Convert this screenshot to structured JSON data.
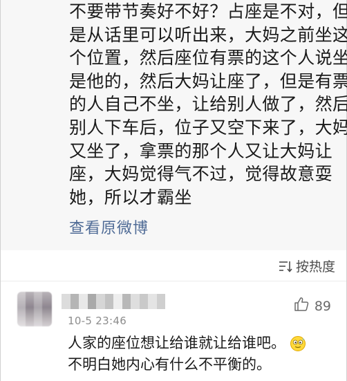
{
  "post": {
    "lines": [
      "不要带节奏好不好？占座是不对，但",
      "是从话里可以听出来，大妈之前坐这",
      "个位置，然后座位有票的这个人说坐",
      "是他的，然后大妈让座了，但是有票",
      "的人自己不坐，让给别人做了，然后",
      "别人下车后，位子又空下来了，大妈",
      "又坐了，拿票的那个人又让大妈让",
      "座，大妈觉得气不过，觉得故意耍",
      "她，所以才霸坐"
    ],
    "view_original": "查看原微博"
  },
  "sort": {
    "label": "按热度",
    "icon": "sort-lines-icon"
  },
  "comment": {
    "timestamp": "10-5 23:46",
    "likes": "89",
    "lines": [
      "人家的座位想让给谁就让给谁吧。",
      "不明白她内心有什么不平衡的。"
    ],
    "emoji_icon": "sweat-smile-emoji-icon",
    "like_icon": "thumbs-up-icon",
    "colors": {
      "link": "#4f6b96",
      "post_background": "#f7f7f7",
      "timestamp": "#8c8c8c"
    }
  }
}
